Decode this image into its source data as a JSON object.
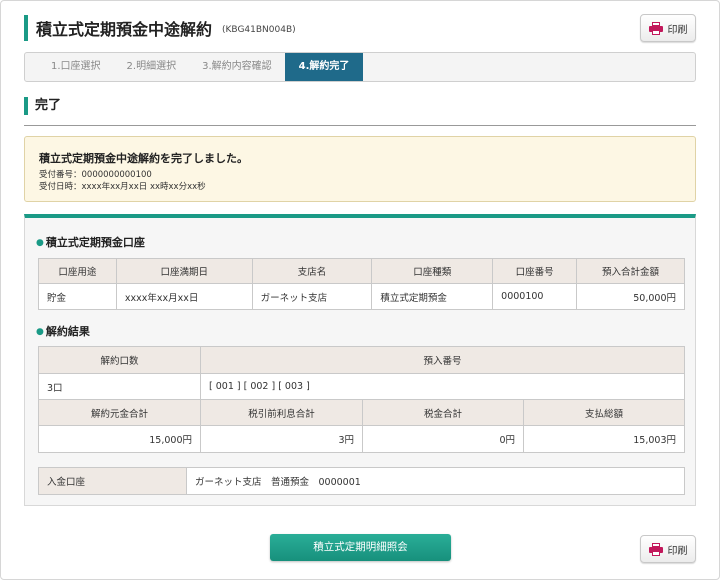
{
  "page": {
    "title": "積立式定期預金中途解約",
    "code": "(KBG41BN004B)",
    "print_label": "印刷"
  },
  "steps": [
    {
      "label": "1.口座選択",
      "active": false
    },
    {
      "label": "2.明細選択",
      "active": false
    },
    {
      "label": "3.解約内容確認",
      "active": false
    },
    {
      "label": "4.解約完了",
      "active": true
    }
  ],
  "section": {
    "title": "完了"
  },
  "notice": {
    "message": "積立式定期預金中途解約を完了しました。",
    "receipt_no": "受付番号：0000000000100",
    "receipt_datetime": "受付日時：xxxx年xx月xx日 xx時xx分xx秒"
  },
  "account": {
    "heading": "積立式定期預金口座",
    "headers": [
      "口座用途",
      "口座満期日",
      "支店名",
      "口座種類",
      "口座番号",
      "預入合計金額"
    ],
    "row": [
      "貯金",
      "xxxx年xx月xx日",
      "ガーネット支店",
      "積立式定期預金",
      "0000100",
      "50,000円"
    ]
  },
  "result": {
    "heading": "解約結果",
    "h_count": "解約口数",
    "h_deposit_no": "預入番号",
    "count": "3口",
    "deposit_numbers": "[ 001 ] [ 002 ] [ 003 ]",
    "h_principal": "解約元金合計",
    "h_pretax_interest": "税引前利息合計",
    "h_tax": "税金合計",
    "h_payment": "支払総額",
    "principal": "15,000円",
    "pretax_interest": "3円",
    "tax": "0円",
    "payment": "15,003円"
  },
  "deposit_account": {
    "label": "入金口座",
    "value": "ガーネット支店　普通預金　0000001"
  },
  "footer": {
    "inquiry_button": "積立式定期明細照会",
    "print_label": "印刷"
  },
  "colors": {
    "accent": "#1a9a86",
    "step_active": "#1f6a8a",
    "print_icon": "#c2185b"
  }
}
